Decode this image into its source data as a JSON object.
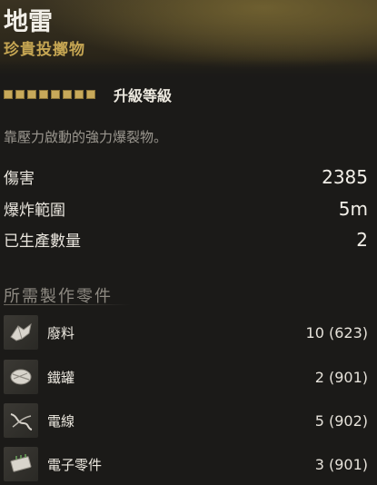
{
  "item": {
    "name": "地雷",
    "rarity": "珍貴投擲物",
    "upgrade_label": "升級等級",
    "upgrade_level": 8,
    "upgrade_max": 8,
    "description": "靠壓力啟動的強力爆裂物。"
  },
  "stats": [
    {
      "label": "傷害",
      "value": "2385"
    },
    {
      "label": "爆炸範圍",
      "value": "5m"
    },
    {
      "label": "已生產數量",
      "value": "2"
    }
  ],
  "parts_section": {
    "title": "所需製作零件",
    "parts": [
      {
        "name": "廢料",
        "count": "10 (623)",
        "icon": "scrap-icon"
      },
      {
        "name": "鐵罐",
        "count": "2 (901)",
        "icon": "tin-can-icon"
      },
      {
        "name": "電線",
        "count": "5 (902)",
        "icon": "wire-icon"
      },
      {
        "name": "電子零件",
        "count": "3 (901)",
        "icon": "electronics-icon"
      }
    ]
  },
  "colors": {
    "accent": "#c6a653",
    "muted": "#9b978f"
  }
}
